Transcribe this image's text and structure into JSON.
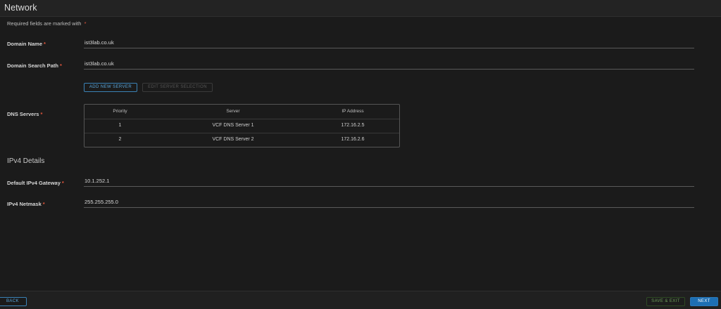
{
  "header": {
    "title": "Network"
  },
  "required_note": {
    "text": "Required fields are marked with",
    "marker": "*"
  },
  "form": {
    "domain_name": {
      "label": "Domain Name",
      "value": "ist3lab.co.uk"
    },
    "domain_search_path": {
      "label": "Domain Search Path",
      "value": "ist3lab.co.uk"
    },
    "dns_buttons": {
      "add": "ADD NEW SERVER",
      "edit": "EDIT SERVER SELECTION"
    },
    "dns_servers": {
      "label": "DNS Servers",
      "columns": [
        "Priority",
        "Server",
        "IP Address"
      ],
      "rows": [
        [
          "1",
          "VCF DNS Server 1",
          "172.16.2.5"
        ],
        [
          "2",
          "VCF DNS Server 2",
          "172.16.2.6"
        ]
      ]
    },
    "ipv4": {
      "section_title": "IPv4 Details",
      "gateway": {
        "label": "Default IPv4 Gateway",
        "value": "10.1.252.1"
      },
      "netmask": {
        "label": "IPv4 Netmask",
        "value": "255.255.255.0"
      }
    }
  },
  "footer": {
    "back": "BACK",
    "save_exit": "SAVE & EXIT",
    "next": "NEXT"
  },
  "colors": {
    "accent": "#1d6fb4",
    "required": "#e4573c",
    "save": "#6ea05a"
  }
}
